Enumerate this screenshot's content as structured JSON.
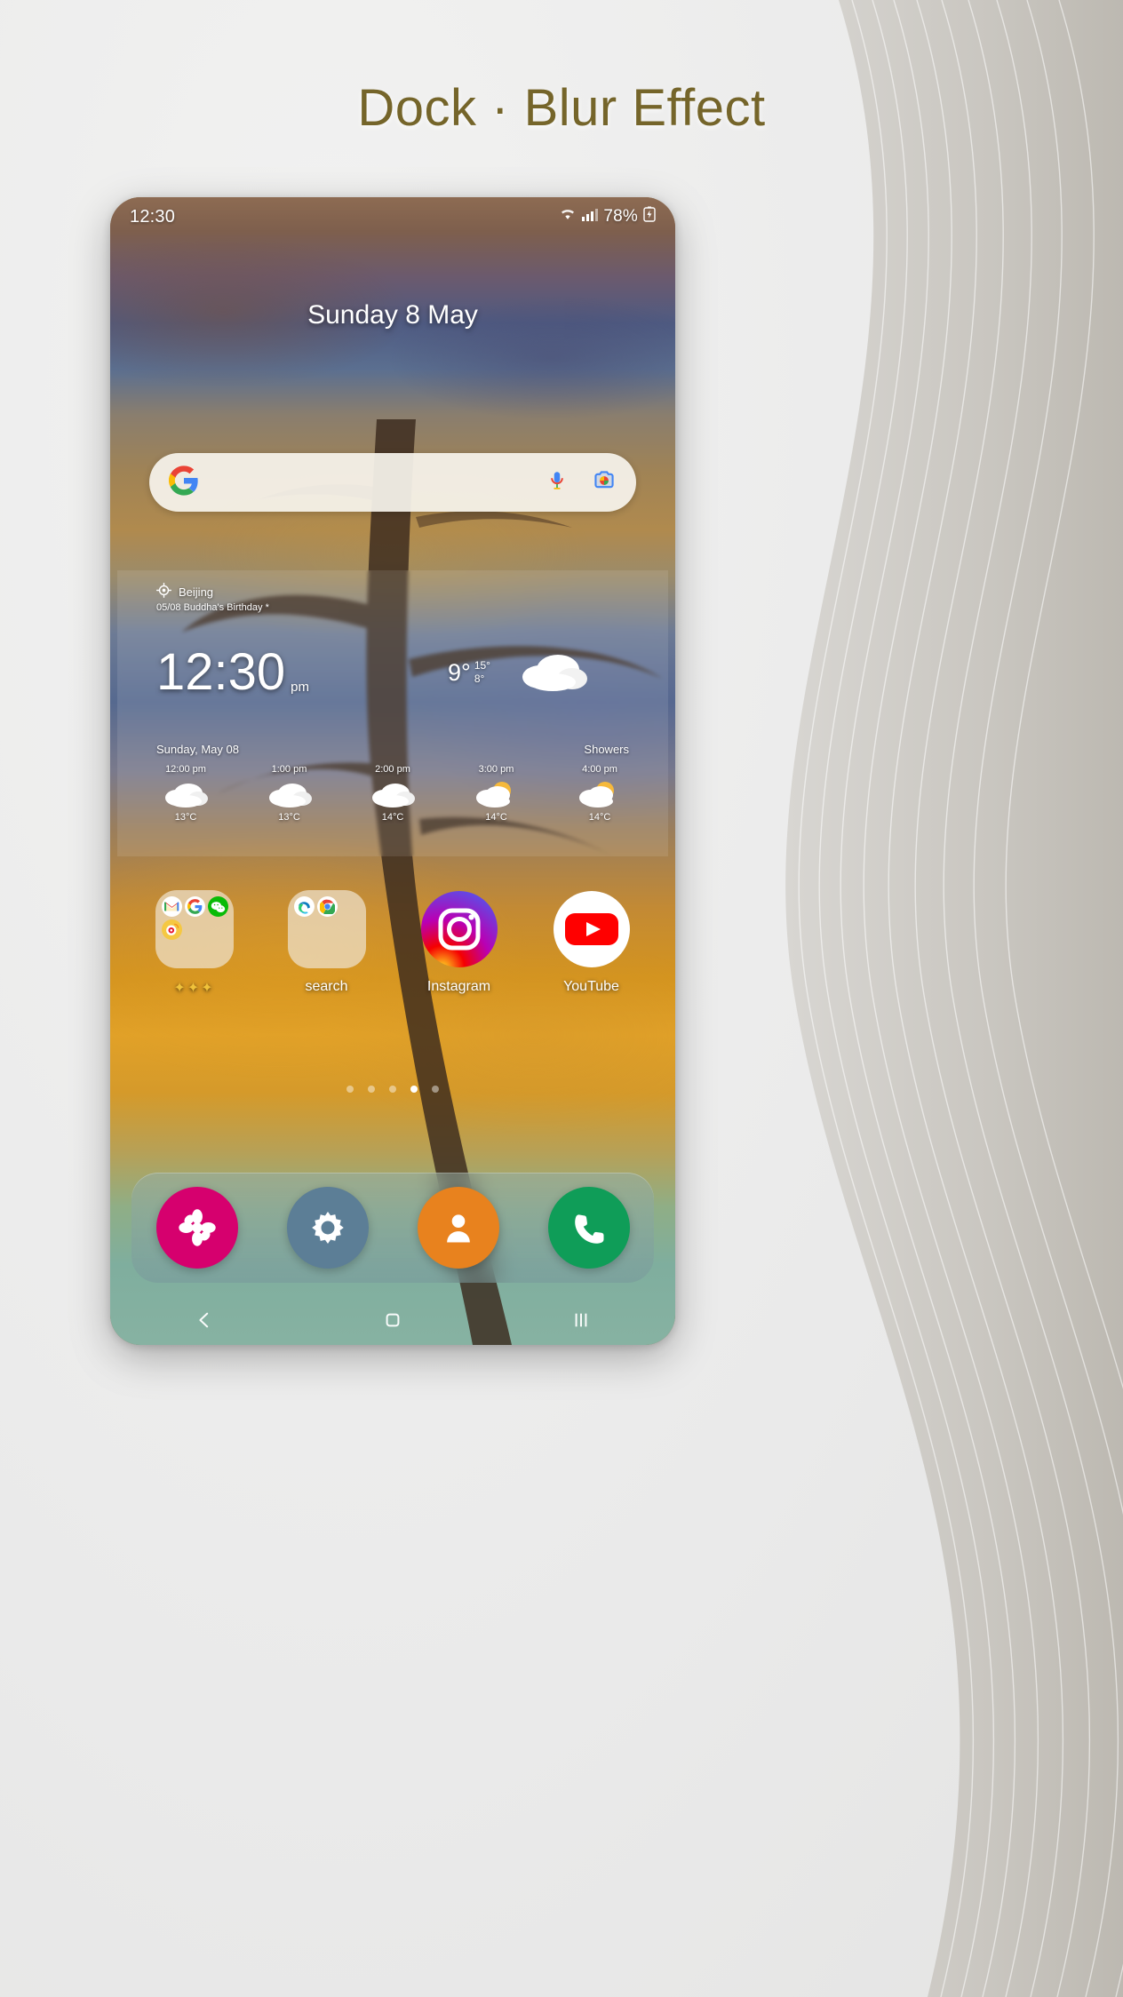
{
  "page": {
    "title": "Dock · Blur Effect",
    "accent_color": "#75652a",
    "background_color": "#ececec"
  },
  "phone": {
    "status_bar": {
      "time": "12:30",
      "battery_percent": "78%",
      "icons": [
        "wifi-icon",
        "signal-icon",
        "battery-charging-icon"
      ]
    },
    "date_header": "Sunday 8 May",
    "search": {
      "placeholder": "",
      "value": "",
      "logo": "google-g-icon",
      "mic_icon": "microphone-icon",
      "lens_icon": "camera-lens-icon"
    },
    "widget": {
      "location": "Beijing",
      "location_icon": "location-crosshair-icon",
      "subtitle": "05/08  Buddha's Birthday *",
      "clock_time": "12:30",
      "clock_ampm": "pm",
      "temperature": "9°",
      "temp_high": "15°",
      "temp_low": "8°",
      "condition_icon": "cloud-icon",
      "day_label": "Sunday, May 08",
      "condition": "Showers",
      "hourly": [
        {
          "time": "12:00 pm",
          "icon": "cloud-icon",
          "temp": "13°C"
        },
        {
          "time": "1:00 pm",
          "icon": "cloud-icon",
          "temp": "13°C"
        },
        {
          "time": "2:00 pm",
          "icon": "cloud-icon",
          "temp": "14°C"
        },
        {
          "time": "3:00 pm",
          "icon": "sun-cloud-icon",
          "temp": "14°C"
        },
        {
          "time": "4:00 pm",
          "icon": "sun-cloud-icon",
          "temp": "14°C"
        }
      ]
    },
    "apps": [
      {
        "label": "✦✦✦",
        "type": "folder",
        "mini_icons": [
          "gmail-icon",
          "google-icon",
          "wechat-icon",
          "weibo-icon"
        ]
      },
      {
        "label": "search",
        "type": "folder",
        "mini_icons": [
          "edge-icon",
          "chrome-icon"
        ]
      },
      {
        "label": "Instagram",
        "type": "app",
        "icon": "instagram-icon"
      },
      {
        "label": "YouTube",
        "type": "app",
        "icon": "youtube-icon"
      }
    ],
    "page_indicator": {
      "count": 5,
      "active_index": 3
    },
    "dock": [
      {
        "name": "gallery-flower-icon",
        "color": "#d6006e"
      },
      {
        "name": "settings-gear-icon",
        "color": "#5c7e96"
      },
      {
        "name": "contacts-person-icon",
        "color": "#e8821e"
      },
      {
        "name": "phone-handset-icon",
        "color": "#0f9d58"
      }
    ],
    "navbar": [
      {
        "name": "back-button",
        "glyph": "back-arrow-icon"
      },
      {
        "name": "home-button",
        "glyph": "home-square-icon"
      },
      {
        "name": "recents-button",
        "glyph": "recents-bars-icon"
      }
    ]
  }
}
